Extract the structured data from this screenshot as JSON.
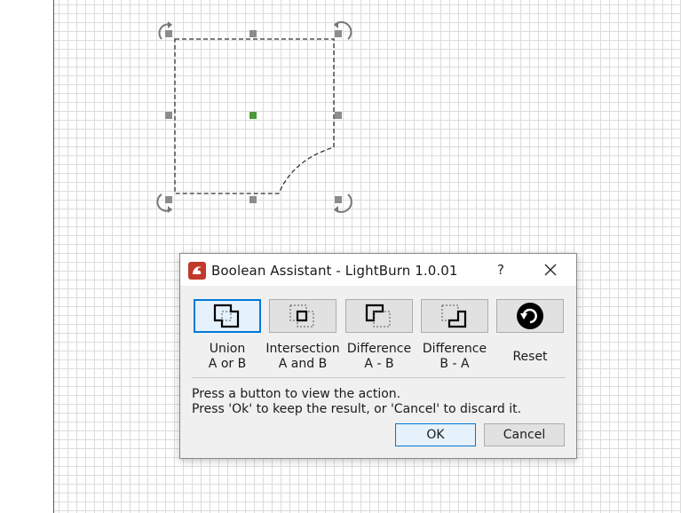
{
  "dialog": {
    "title": "Boolean Assistant - LightBurn 1.0.01",
    "help_label": "?",
    "operations": [
      {
        "line1": "Union",
        "line2": "A or B",
        "icon": "union-icon",
        "selected": true
      },
      {
        "line1": "Intersection",
        "line2": "A and B",
        "icon": "intersection-icon",
        "selected": false
      },
      {
        "line1": "Difference",
        "line2": "A - B",
        "icon": "difference-a-b-icon",
        "selected": false
      },
      {
        "line1": "Difference",
        "line2": "B - A",
        "icon": "difference-b-a-icon",
        "selected": false
      },
      {
        "line1": "Reset",
        "line2": "",
        "icon": "reset-icon",
        "selected": false
      }
    ],
    "instruction_line1": "Press a button to view the action.",
    "instruction_line2": "Press 'Ok' to keep the result, or 'Cancel' to discard it.",
    "ok_label": "OK",
    "cancel_label": "Cancel"
  },
  "colors": {
    "accent": "#0078d7",
    "dialog_bg": "#f0f0f0",
    "grid_line": "#dcdcdc",
    "center_handle": "#4a9a3a",
    "handle": "#8c8c8c",
    "app_icon": "#c0392b"
  }
}
